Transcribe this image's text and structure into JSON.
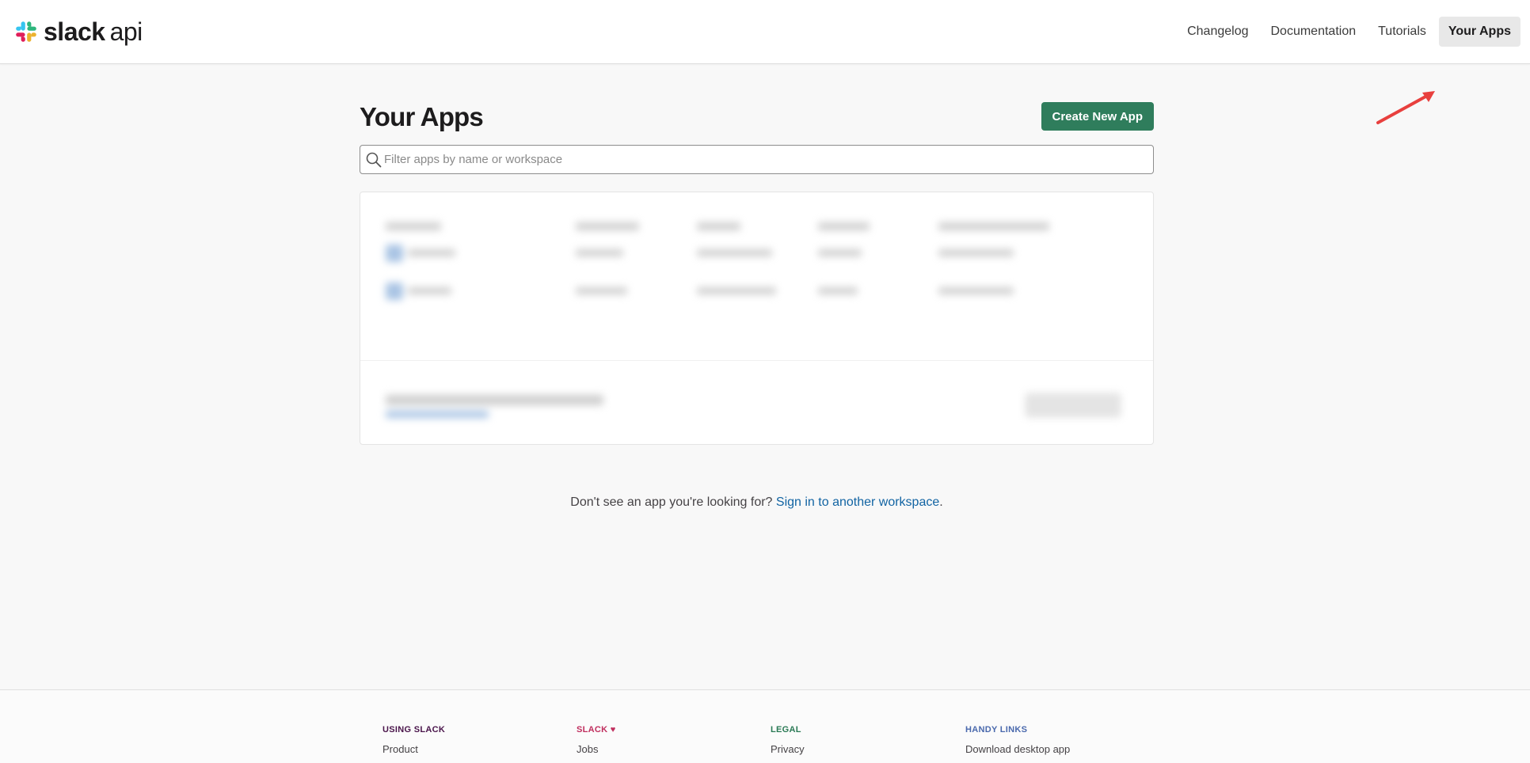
{
  "header": {
    "brand_bold": "slack",
    "brand_light": "api",
    "nav": [
      {
        "label": "Changelog",
        "active": false
      },
      {
        "label": "Documentation",
        "active": false
      },
      {
        "label": "Tutorials",
        "active": false
      },
      {
        "label": "Your Apps",
        "active": true
      }
    ]
  },
  "main": {
    "title": "Your Apps",
    "create_button": "Create New App",
    "search_placeholder": "Filter apps by name or workspace",
    "search_icon": "search-icon",
    "help_text": "Don't see an app you're looking for?",
    "help_link": "Sign in to another workspace",
    "help_end": "."
  },
  "annotation": {
    "color": "#e8403e",
    "icon": "arrow-icon"
  },
  "footer": {
    "columns": [
      {
        "heading": "USING SLACK",
        "link": "Product",
        "color": "#4a154b"
      },
      {
        "heading": "SLACK",
        "heart": "♥",
        "link": "Jobs",
        "color": "#c02e5e"
      },
      {
        "heading": "LEGAL",
        "link": "Privacy",
        "color": "#2a7a55"
      },
      {
        "heading": "HANDY LINKS",
        "link": "Download desktop app",
        "color": "#4a69ad"
      }
    ]
  },
  "colors": {
    "accent": "#2f7d5c",
    "link": "#1264a3",
    "background": "#f8f8f8"
  }
}
